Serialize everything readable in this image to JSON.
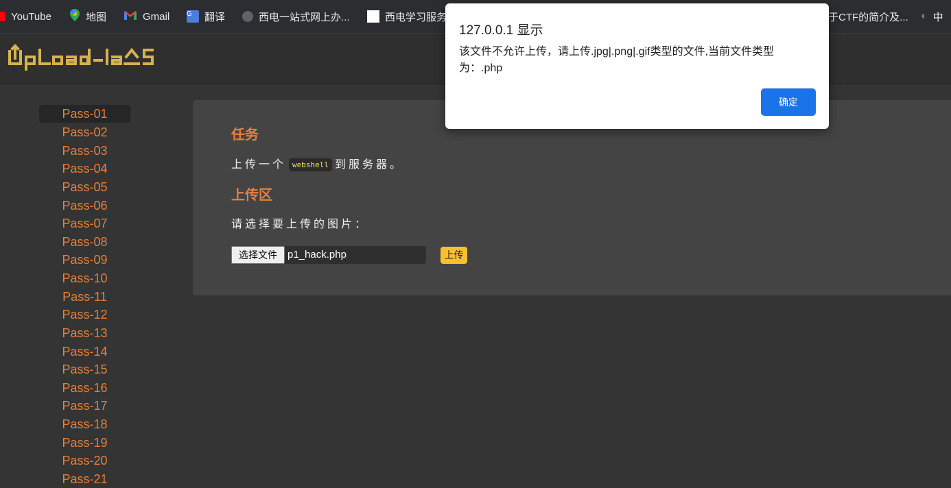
{
  "bookmarks": [
    {
      "label": "YouTube",
      "icon": "youtube-icon"
    },
    {
      "label": "地图",
      "icon": "maps-pin-icon"
    },
    {
      "label": "Gmail",
      "icon": "gmail-icon"
    },
    {
      "label": "翻译",
      "icon": "translate-icon"
    },
    {
      "label": "西电一站式网上办...",
      "icon": "globe-icon"
    },
    {
      "label": "西电学习服务",
      "icon": "page-icon"
    },
    {
      "label": "于CTF的简介及...",
      "icon": null
    },
    {
      "label": "中",
      "icon": "half-circle-icon"
    }
  ],
  "header": {
    "logo_text": "UpLoad-labs"
  },
  "sidebar": {
    "items": [
      "Pass-01",
      "Pass-02",
      "Pass-03",
      "Pass-04",
      "Pass-05",
      "Pass-06",
      "Pass-07",
      "Pass-08",
      "Pass-09",
      "Pass-10",
      "Pass-11",
      "Pass-12",
      "Pass-13",
      "Pass-14",
      "Pass-15",
      "Pass-16",
      "Pass-17",
      "Pass-18",
      "Pass-19",
      "Pass-20",
      "Pass-21"
    ],
    "active_index": 0
  },
  "main": {
    "task_title": "任务",
    "task_text_before": "上传一个",
    "task_code": "webshell",
    "task_text_after": "到服务器。",
    "upload_title": "上传区",
    "upload_prompt": "请选择要上传的图片：",
    "choose_file_label": "选择文件",
    "file_name": "p1_hack.php",
    "upload_button_label": "上传"
  },
  "dialog": {
    "title": "127.0.0.1 显示",
    "message": "该文件不允许上传，请上传.jpg|.png|.gif类型的文件,当前文件类型为：.php",
    "ok_label": "确定"
  },
  "colors": {
    "accent": "#e8803a",
    "upload_button": "#f7c12e",
    "dialog_button": "#1a73e8",
    "logo": "#d8b24f"
  }
}
